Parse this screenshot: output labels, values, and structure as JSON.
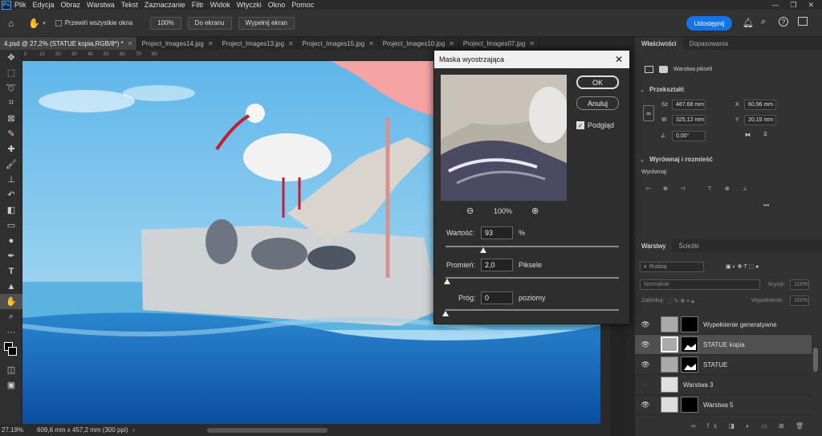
{
  "menubar": {
    "logo": "Ps",
    "items": [
      "Plik",
      "Edycja",
      "Obraz",
      "Warstwa",
      "Tekst",
      "Zaznaczanie",
      "Filtr",
      "Widok",
      "Wtyczki",
      "Okno",
      "Pomoc"
    ]
  },
  "options": {
    "scroll_all": "Przewiń wszystkie okna",
    "zoom100": "100%",
    "fit_screen": "Do ekranu",
    "fill_screen": "Wypełnij ekran",
    "share": "Udostępnij"
  },
  "tabs": [
    {
      "label": "4.psd @ 27,2% (STATUE kopia,RGB/8*) *",
      "active": true
    },
    {
      "label": "Project_Images14.jpg",
      "active": false
    },
    {
      "label": "Project_Images13.jpg",
      "active": false
    },
    {
      "label": "Project_Images15.jpg",
      "active": false
    },
    {
      "label": "Project_Images10.jpg",
      "active": false
    },
    {
      "label": "Project_Images07.jpg",
      "active": false
    }
  ],
  "ruler": [
    "0",
    "10",
    "20",
    "30",
    "40",
    "50",
    "60",
    "70",
    "80"
  ],
  "status": {
    "zoom": "27.19%",
    "size": "609,6 mm x 457,2 mm (300 ppi)"
  },
  "dialog": {
    "title": "Maska wyostrzająca",
    "ok": "OK",
    "cancel": "Anuluj",
    "preview": "Podgląd",
    "preview_zoom": "100%",
    "amount_label": "Wartość:",
    "amount_value": "93",
    "amount_unit": "%",
    "amount_fraction": 0.216,
    "radius_label": "Promień:",
    "radius_value": "2,0",
    "radius_unit": "Piksele",
    "radius_fraction": 0.01,
    "threshold_label": "Próg:",
    "threshold_value": "0",
    "threshold_unit": "poziomy",
    "threshold_fraction": 0.0
  },
  "properties": {
    "tabs": [
      "Właściwości",
      "Dopasowania"
    ],
    "layer_kind": "Warstwa pikseli",
    "transform_title": "Przekształć",
    "w_label": "Sz",
    "w_value": "487,68 mm",
    "h_label": "W",
    "h_value": "325,12 mm",
    "x_label": "X",
    "x_value": "60,96 mm",
    "y_label": "Y",
    "y_value": "20,15 mm",
    "angle_value": "0,00°",
    "align_title": "Wyrównaj i rozmieść",
    "align_label": "Wyrównaj:"
  },
  "layers": {
    "tabs": [
      "Warstwy",
      "Ścieżki"
    ],
    "search_placeholder": "Rodzaj",
    "blend_mode": "Normalnie",
    "opacity_label": "Krycie:",
    "opacity_value": "100%",
    "lock_label": "Zablokuj:",
    "fill_label": "Wypełnienie:",
    "fill_value": "100%",
    "items": [
      {
        "name": "Wypełnienie generatywne",
        "visible": true,
        "selected": false
      },
      {
        "name": "STATUE kopia",
        "visible": true,
        "selected": true
      },
      {
        "name": "STATUE",
        "visible": true,
        "selected": false
      },
      {
        "name": "Warstwa 3",
        "visible": false,
        "selected": false
      },
      {
        "name": "Warstwa 5",
        "visible": true,
        "selected": false
      }
    ]
  }
}
